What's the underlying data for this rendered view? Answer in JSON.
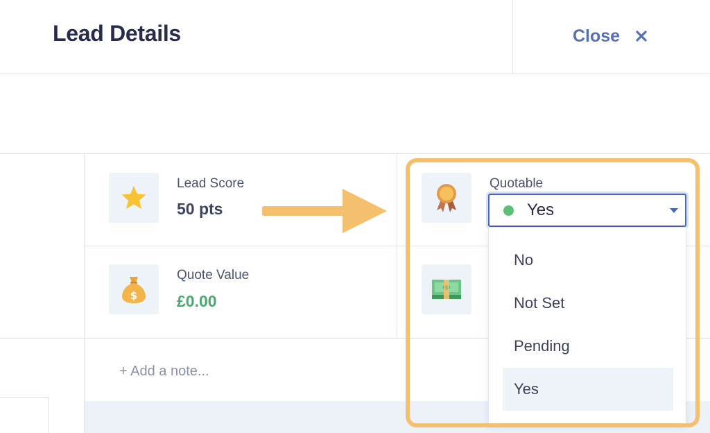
{
  "header": {
    "title": "Lead Details",
    "close_label": "Close"
  },
  "fields": {
    "lead_score": {
      "label": "Lead Score",
      "value": "50 pts",
      "icon": "star-icon"
    },
    "quotable": {
      "label": "Quotable",
      "icon": "award-ribbon-icon"
    },
    "quote_value": {
      "label": "Quote Value",
      "value": "£0.00",
      "icon": "money-bag-icon"
    },
    "fourth_icon": "banknotes-icon"
  },
  "note": {
    "placeholder": "+ Add a note..."
  },
  "dropdown": {
    "selected": "Yes",
    "status_color": "#5bbf7a",
    "options": [
      "No",
      "Not Set",
      "Pending",
      "Yes"
    ]
  },
  "colors": {
    "accent": "#5670b5",
    "highlight": "#f5c06e",
    "money": "#4aa870"
  }
}
